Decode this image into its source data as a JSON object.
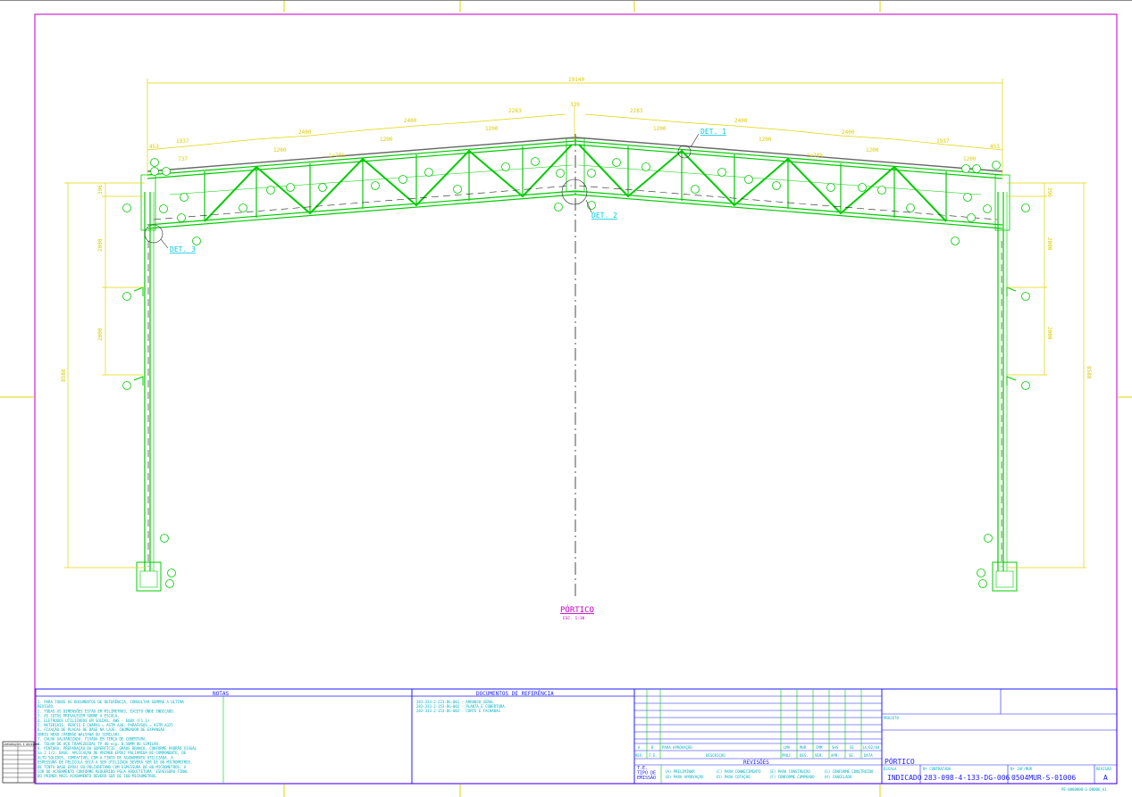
{
  "drawing": {
    "overall_span": "19140",
    "top_dims": [
      "453",
      "1937",
      "2400",
      "2400",
      "2283",
      "339",
      "2283",
      "2400",
      "2400",
      "1937",
      "453"
    ],
    "purlin_spacing": [
      "737",
      "1200",
      "1200",
      "1200",
      "1200",
      "1200",
      "1200",
      "1200",
      "737"
    ],
    "slope_labels": [
      "i=10%",
      "i=10%"
    ],
    "vertical_dims": [
      "396",
      "2000",
      "2000",
      "8588"
    ],
    "details": [
      "DET. 1",
      "DET. 2",
      "DET. 3"
    ],
    "title": "PÓRTICO",
    "scale": "ESC. 1:30"
  },
  "title_block": {
    "notes": {
      "header": "NOTAS",
      "lines": [
        "1.  PARA TODOS OS DOCUMENTOS DE REFERÊNCIA, CONSULTAR SEMPRE A ÚLTIMA",
        "    REVISÃO.",
        "2.  TODAS AS DIMENSÕES ESTÃO EM MILÍMETROS, EXCETO ONDE INDICADO.",
        "3.  AS COTAS PREVALECEM SOBRE A ESCALA.",
        "4.  ELETRODOS UTILIZADOS EM SOLDAS: AWS - E60X (F1.1)",
        "5.  MATERIAIS:  PERFIS E CHAPAS = ASTM A36, PARAFUSOS = ASTM A325",
        "6.  FIXAÇÃO DE PLACAS DE BASE NA LAJE: CHUMBADOR DE EXPANSÃO",
        "    OBRIG HEAD (PADRÃO WALSYWA OU SIMILAR).",
        "7.  CALHA GALVANIZADA, FIXADA EM TERÇA DE COBERTURA.",
        "8.  TELHA DE AÇO TRAPEZOIDAL TP 40 esp. 0,50MM OU SIMILAR.",
        "9.  PINTURA: PREPARAÇÃO DA SUPERFÍCIE: GRAUS BRANCO, CONFORME PADRÃO VISUAL",
        "    Sa 2 1/2; BASE: APLICAÇÃO DE PRIMER EPÓXI POLIAMIDA BI-COMPONENTE, DE",
        "    ALTO SÓLIDOS, COMPATÍVEL COM A TINTA DE ACABAMENTO UTILIZADA. A",
        "    ESPESSURA DE PELÍCULA SECA A SER UTILIZADA DEVERÁ SER DE 80 MICROMETROS.",
        "    DE TINTA BASE EPÓXI OU POLIURETANO COM ESPESSURA DE 80 MICROMETROS. A",
        "    COR DO ACABAMENTO CONFORME REQUERIDO PELA ARQUITETURA. ESPESSURA FINAL",
        "    DO PRIMER MAIS ACABAMENTO DEVERÁ SER DE 160 MICROMETROS."
      ]
    },
    "references": {
      "header": "DOCUMENTOS DE REFERÊNCIA",
      "lines": [
        "283-333-2-223-DG-001 - ARRANJO GERAL",
        "283-333-2-153-DG-002 - PLANTA E COBERTURA",
        "283-333-2-153-DG-003 - CORTE E FACHADAS"
      ]
    },
    "revisions": {
      "header": "REVISÕES",
      "row": [
        "A",
        "B",
        "PARA APROVAÇÃO",
        "LMA",
        "MUR",
        "CMM",
        "SHS",
        "SE",
        "14/02/04"
      ],
      "cols": [
        "REV.",
        "T.E.",
        "DESCRIÇÃO",
        "PROJ.",
        "DES.",
        "VER.",
        "APR.",
        "SE.",
        "DATA"
      ],
      "tipo_label": "T.E.\nTIPO DE\nEMISSÃO",
      "tipo_codes": [
        "(A) PRELIMINAR",
        "(B) PARA APROVAÇÃO",
        "(C) PARA CONHECIMENTO",
        "(D) PARA COTAÇÃO",
        "(E) PARA CONSTRUÇÃO",
        "(F) CONFORME COMPRADO",
        "(G) CONFORME CONSTRUÍDO",
        "(H) CANCELADO"
      ]
    },
    "info": {
      "projeto_label": "PROJETO",
      "drawing_title": "PÓRTICO",
      "escala_label": "ESCALA",
      "escala": "INDICADO",
      "contratada_label": "Nº CONTRATADA",
      "contratada": "283-098-4-133-DG-006",
      "jaf_label": "Nº JAF/MUR",
      "jaf": "0504MUR-S-01006",
      "revisao_label": "REVISÃO",
      "revisao": "A",
      "footer_code": "PE-0000000-G-00006_A1"
    },
    "side_table_header": "INFORMAÇÕES E REVISÕES"
  },
  "colors": {
    "frame": "#d020d0",
    "truss": "#00cc00",
    "dimension": "#e0d400",
    "detail": "#00c0e0",
    "title_block": "#1a1aff"
  }
}
